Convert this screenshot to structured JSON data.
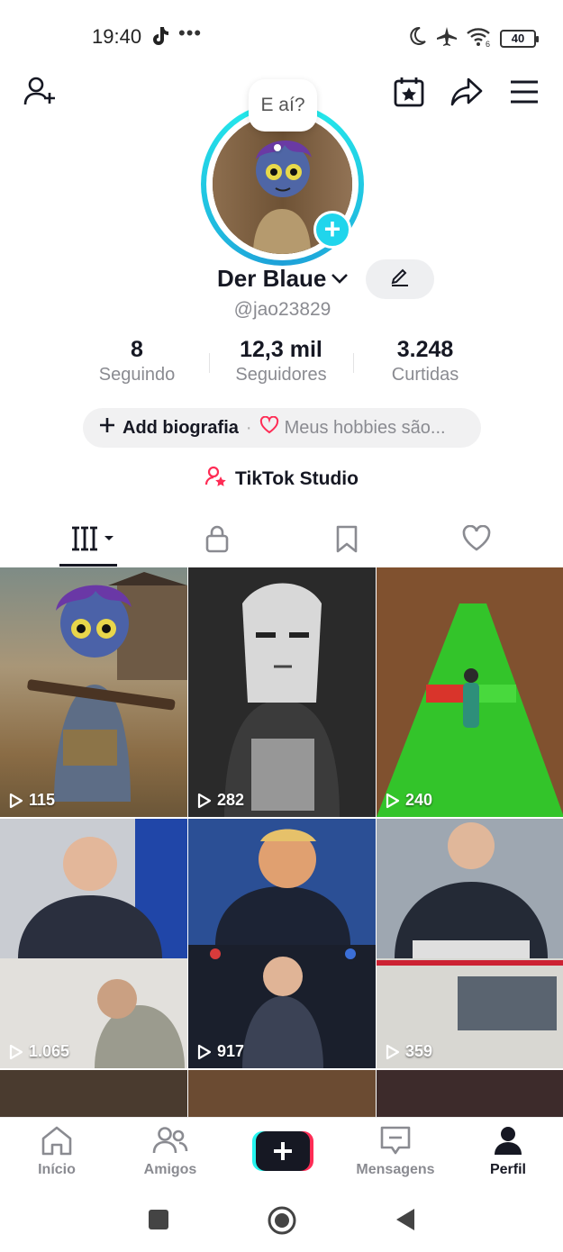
{
  "status_bar": {
    "time": "19:40",
    "tiktok_icon": "tiktok-note-icon",
    "dots": "•••",
    "battery": "40",
    "icons": [
      "moon-icon",
      "airplane-icon",
      "wifi-icon",
      "battery-icon"
    ]
  },
  "header": {
    "left_icon": "add-friend-icon",
    "right_icons": [
      "calendar-star-icon",
      "share-icon",
      "menu-icon"
    ]
  },
  "profile": {
    "speech_bubble": "E aí?",
    "display_name": "Der Blaue",
    "username": "@jao23829",
    "stats": [
      {
        "value": "8",
        "label": "Seguindo"
      },
      {
        "value": "12,3 mil",
        "label": "Seguidores"
      },
      {
        "value": "3.248",
        "label": "Curtidas"
      }
    ],
    "bio_add": "Add biografia",
    "bio_hint": "Meus hobbies são...",
    "studio": "TikTok Studio"
  },
  "tabs": [
    "videos-grid-icon",
    "lock-icon",
    "bookmark-icon",
    "heart-icon"
  ],
  "videos": [
    {
      "views": "115"
    },
    {
      "views": "282"
    },
    {
      "views": "240"
    },
    {
      "views": "1.065"
    },
    {
      "views": "917"
    },
    {
      "views": "359"
    }
  ],
  "bottom_nav": [
    {
      "label": "Início",
      "icon": "home-icon"
    },
    {
      "label": "Amigos",
      "icon": "friends-icon"
    },
    {
      "label": "",
      "icon": "create-plus-icon"
    },
    {
      "label": "Mensagens",
      "icon": "inbox-icon"
    },
    {
      "label": "Perfil",
      "icon": "profile-icon",
      "active": true
    }
  ],
  "colors": {
    "accent_cyan": "#20d5ec",
    "accent_pink": "#fe2c55",
    "text": "#161823",
    "muted": "#8a8b91"
  }
}
